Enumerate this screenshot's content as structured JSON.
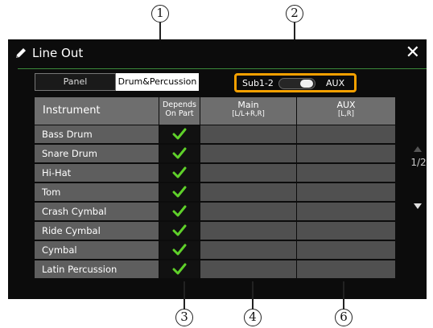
{
  "window": {
    "title": "Line Out",
    "close_glyph": "✕",
    "title_icon": "pencil-icon"
  },
  "tabs": [
    {
      "label": "Panel",
      "active": false
    },
    {
      "label": "Drum&Percussion",
      "active": true
    }
  ],
  "toggle": {
    "left_label": "Sub1-2",
    "right_label": "AUX",
    "value": "AUX"
  },
  "table": {
    "headers": {
      "instrument": "Instrument",
      "depends_line1": "Depends",
      "depends_line2": "On Part",
      "main_line1": "Main",
      "main_line2": "[L/L+R,R]",
      "aux_line1": "AUX",
      "aux_line2": "[L,R]"
    },
    "rows": [
      {
        "instrument": "Bass Drum",
        "depends_on_part": true
      },
      {
        "instrument": "Snare Drum",
        "depends_on_part": true
      },
      {
        "instrument": "Hi-Hat",
        "depends_on_part": true
      },
      {
        "instrument": "Tom",
        "depends_on_part": true
      },
      {
        "instrument": "Crash Cymbal",
        "depends_on_part": true
      },
      {
        "instrument": "Ride Cymbal",
        "depends_on_part": true
      },
      {
        "instrument": "Cymbal",
        "depends_on_part": true
      },
      {
        "instrument": "Latin Percussion",
        "depends_on_part": true
      }
    ]
  },
  "pager": {
    "label": "1/2"
  },
  "callouts": {
    "c1": "1",
    "c2": "2",
    "c3": "3",
    "c4": "4",
    "c6": "6"
  },
  "colors": {
    "highlight": "#f5a000",
    "check": "#5fd02a",
    "accent_line": "#3a8a3a"
  }
}
